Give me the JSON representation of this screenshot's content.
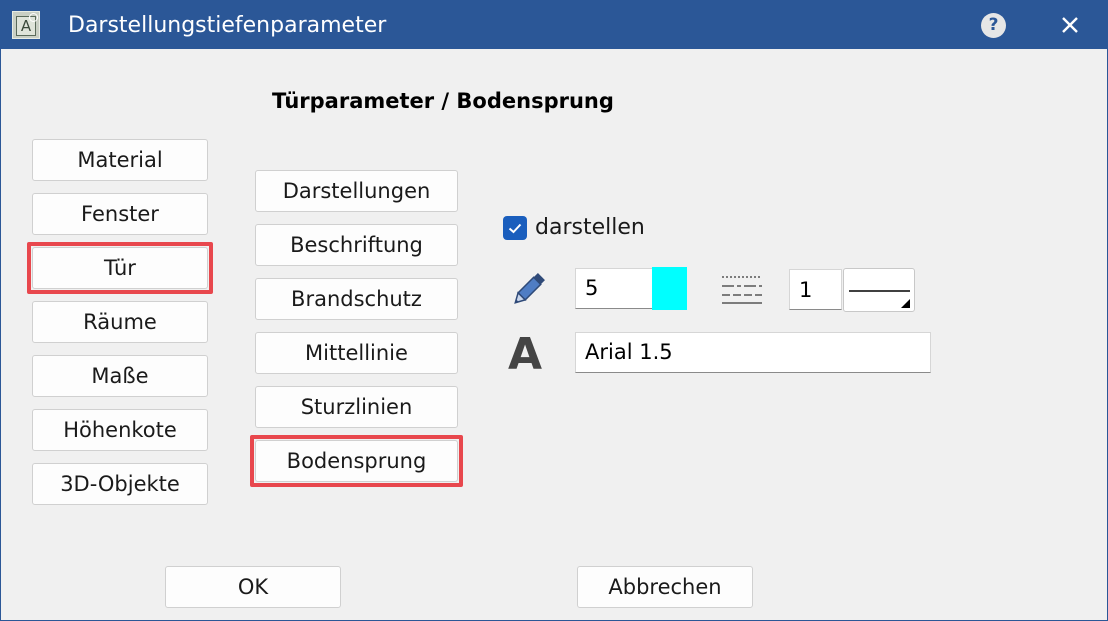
{
  "window": {
    "title": "Darstellungstiefenparameter",
    "app_icon_letter": "A",
    "help_symbol": "?",
    "icons": [
      "app-icon",
      "help-icon",
      "close-icon"
    ]
  },
  "heading": "Türparameter / Bodensprung",
  "categories": [
    {
      "label": "Material",
      "highlighted": false
    },
    {
      "label": "Fenster",
      "highlighted": false
    },
    {
      "label": "Tür",
      "highlighted": true
    },
    {
      "label": "Räume",
      "highlighted": false
    },
    {
      "label": "Maße",
      "highlighted": false
    },
    {
      "label": "Höhenkote",
      "highlighted": false
    },
    {
      "label": "3D-Objekte",
      "highlighted": false
    }
  ],
  "subcategories": [
    {
      "label": "Darstellungen",
      "highlighted": false
    },
    {
      "label": "Beschriftung",
      "highlighted": false
    },
    {
      "label": "Brandschutz",
      "highlighted": false
    },
    {
      "label": "Mittellinie",
      "highlighted": false
    },
    {
      "label": "Sturzlinien",
      "highlighted": false
    },
    {
      "label": "Bodensprung",
      "highlighted": true
    }
  ],
  "settings": {
    "show_checkbox": {
      "label": "darstellen",
      "checked": true
    },
    "pen_value": "5",
    "pen_color": "#00ffff",
    "line_weight_value": "1",
    "font_value": "Arial 1.5",
    "icons": [
      "pen-icon",
      "linetype-icon",
      "text-style-icon",
      "line-style-dropdown"
    ]
  },
  "buttons": {
    "ok": "OK",
    "cancel": "Abbrechen"
  },
  "colors": {
    "titlebar": "#2b5797",
    "highlight": "#e8474d",
    "checkbox": "#1a5ebd"
  }
}
